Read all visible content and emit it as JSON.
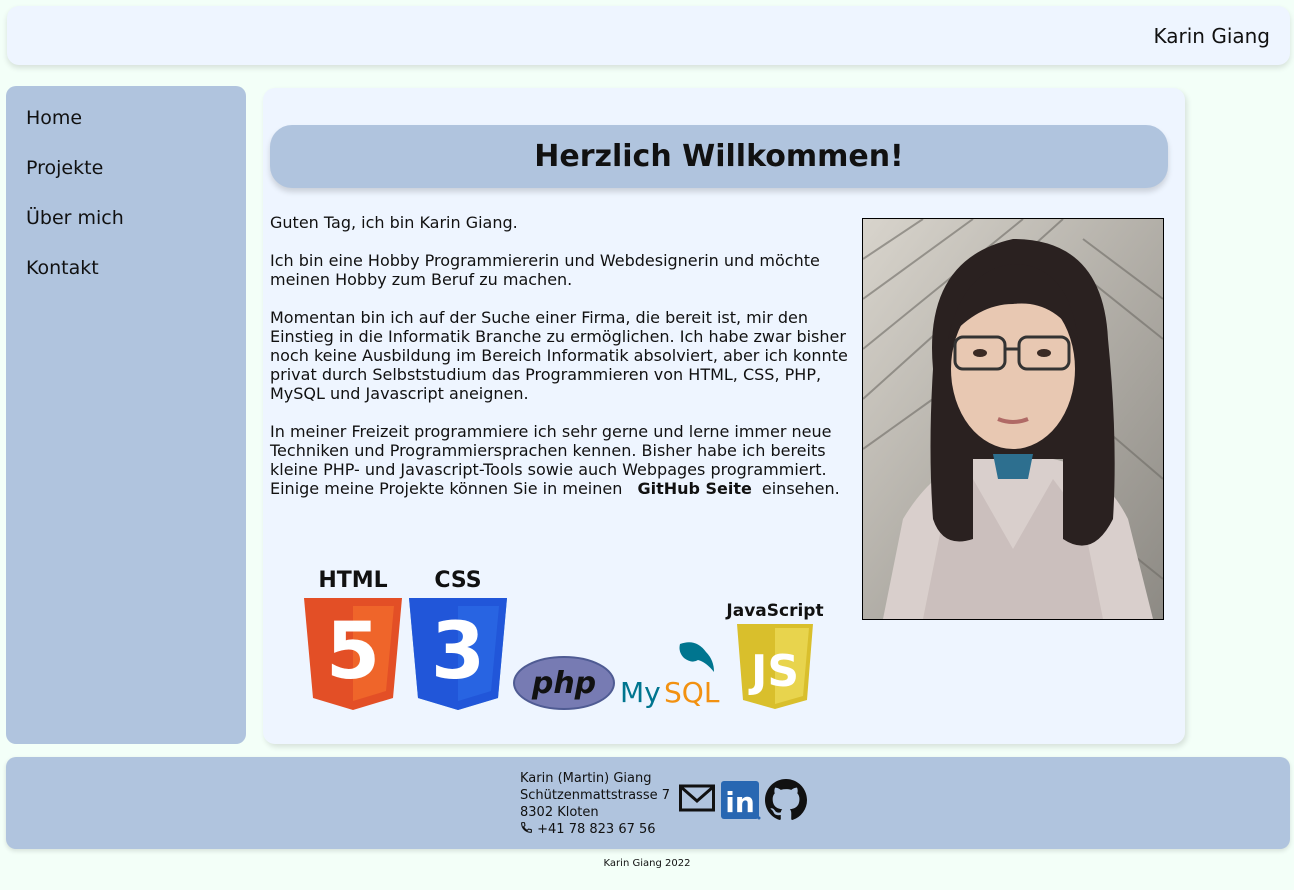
{
  "header": {
    "name": "Karin Giang"
  },
  "nav": [
    {
      "label": "Home"
    },
    {
      "label": "Projekte"
    },
    {
      "label": "Über mich"
    },
    {
      "label": "Kontakt"
    }
  ],
  "main": {
    "title": "Herzlich Willkommen!",
    "p1": "Guten Tag, ich bin Karin Giang.",
    "p2": "Ich bin eine Hobby Programmiererin und Webdesignerin und möchte meinen Hobby zum Beruf zu machen.",
    "p3": "Momentan bin ich auf der Suche einer Firma, die bereit ist, mir den Einstieg in die Informatik Branche zu ermöglichen. Ich habe zwar bisher noch keine Ausbildung im Bereich Informatik absolviert, aber ich konnte privat durch Selbststudium das Programmieren von HTML, CSS, PHP, MySQL und Javascript aneignen.",
    "p4_before": "In meiner Freizeit programmiere ich sehr gerne und lerne immer neue Techniken und Programmiersprachen kennen. Bisher habe ich bereits kleine PHP- und Javascript-Tools sowie auch Webpages programmiert. Einige meine Projekte können Sie in meinen",
    "p4_link": "GitHub Seite",
    "p4_after": "einsehen.",
    "logos": {
      "html": "HTML",
      "html_digit": "5",
      "css": "CSS",
      "css_digit": "3",
      "php": "php",
      "mysql_my": "My",
      "mysql_sql": "SQL",
      "js": "JavaScript",
      "js_letters": "JS"
    }
  },
  "footer": {
    "name": "Karin (Martin) Giang",
    "street": "Schützenmattstrasse 7",
    "city": "8302 Kloten",
    "phone": "+41 78 823 67 56",
    "linkedin": "in",
    "copyright": "Karin Giang 2022"
  },
  "colors": {
    "background": "#f3fff8",
    "panel": "#eef5ff",
    "accent": "#b0c4de",
    "html_orange": "#e34f26",
    "css_blue": "#1572b6",
    "js_yellow": "#d9bf2c",
    "php_purple": "#777bb3",
    "mysql_teal": "#00758f",
    "mysql_orange": "#f29111",
    "linkedin_blue": "#2867b2"
  },
  "icons": [
    "mail-icon",
    "linkedin-icon",
    "github-icon",
    "phone-icon"
  ]
}
